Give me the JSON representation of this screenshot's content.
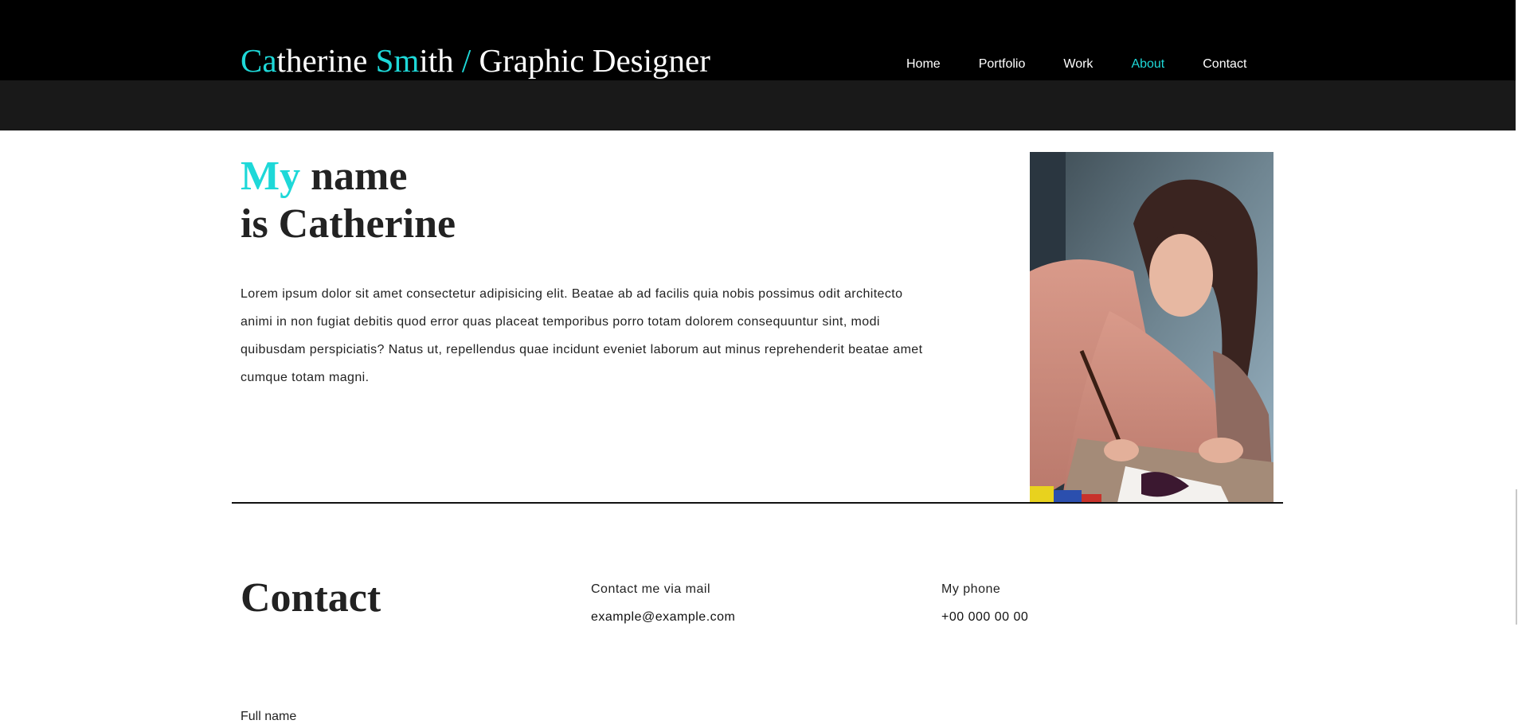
{
  "header": {
    "brand": {
      "part1_accent": "Ca",
      "part1_rest": "therine ",
      "part2_accent": "Sm",
      "part2_rest": "ith ",
      "slash": "/",
      "suffix": " Graphic Designer"
    },
    "nav": [
      {
        "label": "Home"
      },
      {
        "label": "Portfolio"
      },
      {
        "label": "Work"
      },
      {
        "label": "About"
      },
      {
        "label": "Contact"
      }
    ]
  },
  "about": {
    "heading_accent": "My",
    "heading_rest_line1": " name",
    "heading_line2": "is Catherine",
    "bio": "Lorem ipsum dolor sit amet consectetur adipisicing elit. Beatae ab ad facilis quia nobis possimus odit architecto animi in non fugiat debitis quod error quas placeat temporibus porro totam dolorem consequuntur sint, modi quibusdam perspiciatis? Natus ut, repellendus quae incidunt eveniet laborum aut minus reprehenderit beatae amet cumque totam magni."
  },
  "contact": {
    "title": "Contact",
    "mail_label": "Contact me via mail",
    "mail_value": "example@example.com",
    "phone_label": "My phone",
    "phone_value": "+00 000 00 00",
    "form_fullname_label": "Full name"
  },
  "colors": {
    "accent": "#1ed8d8",
    "topbar": "#000000",
    "subbar": "#191919"
  }
}
